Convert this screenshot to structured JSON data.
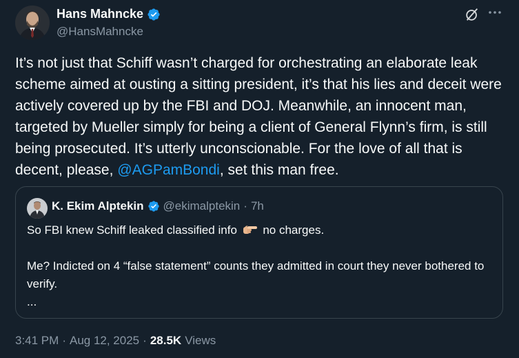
{
  "author": {
    "name": "Hans Mahncke",
    "handle": "@HansMahncke",
    "verified_color": "#1d9bf0"
  },
  "tweet": {
    "text_before_mention": "It’s not just that Schiff wasn’t charged for orchestrating an elaborate leak scheme aimed at ousting a sitting president, it’s that his lies and deceit were actively covered up by the FBI and DOJ. Meanwhile, an innocent man, targeted by Mueller simply for being a client of General Flynn’s firm, is still being prosecuted. It’s utterly unconscionable. For the love of all that is decent, please, ",
    "mention": "@AGPamBondi",
    "text_after_mention": ", set this man free."
  },
  "quote": {
    "name": "K. Ekim Alptekin",
    "handle": "@ekimalptekin",
    "dot": "·",
    "time": "7h",
    "line1_before_icon": "So FBI knew Schiff leaked classified info ",
    "line1_icon": "pointing-right-icon",
    "line1_after_icon": " no charges.",
    "line2": "Me? Indicted on 4 “false statement” counts they admitted in court they never bothered to verify.",
    "line3": "..."
  },
  "meta": {
    "time": "3:41 PM",
    "sep1": "·",
    "date": "Aug 12, 2025",
    "sep2": "·",
    "views_count": "28.5K",
    "views_label": "Views"
  },
  "colors": {
    "background": "#15202b",
    "text": "#f7f9f9",
    "secondary": "#8b98a5",
    "accent": "#1d9bf0",
    "border": "#38444d"
  }
}
